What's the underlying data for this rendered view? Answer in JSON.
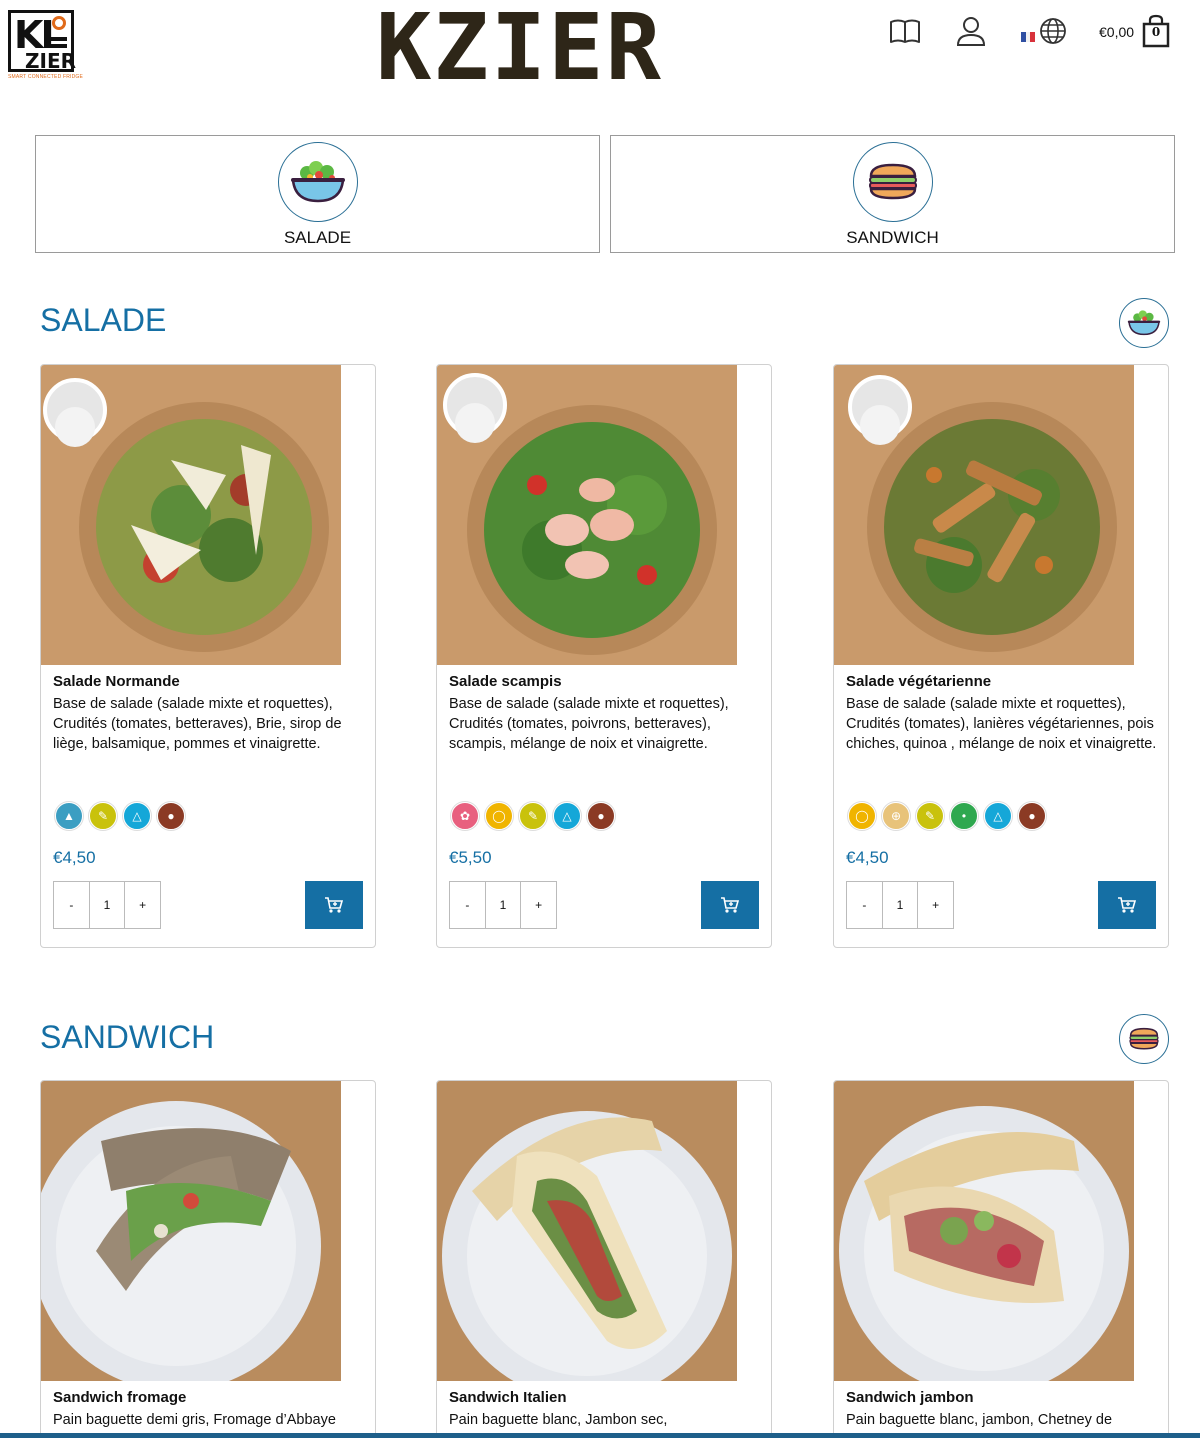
{
  "header": {
    "brand": "KZIER",
    "logo": {
      "text_ki": "KI",
      "text_zier": "ZIER",
      "tagline": "SMART CONNECTED FRIDGE"
    },
    "cart_total": "€0,00",
    "cart_count": "0",
    "icons": [
      "menu-book-icon",
      "account-icon",
      "flag-fr-icon",
      "globe-icon",
      "shopping-bag-icon"
    ]
  },
  "categories": [
    {
      "label": "SALADE",
      "icon": "salad-bowl-icon"
    },
    {
      "label": "SANDWICH",
      "icon": "sandwich-icon"
    }
  ],
  "sections": [
    {
      "title": "SALADE",
      "products": [
        {
          "name": "Salade Normande",
          "description": "Base de salade (salade mixte et roquettes), Crudités (tomates, betteraves), Brie, sirop de liège, balsamique, pommes et vinaigrette.",
          "allergens": [
            "milk-icon",
            "mustard-icon",
            "sulphite-icon",
            "nuts-icon"
          ],
          "price": "€4,50",
          "qty": "1"
        },
        {
          "name": "Salade scampis",
          "description": "Base de salade (salade mixte et roquettes), Crudités (tomates, poivrons, betteraves), scampis, mélange de noix et vinaigrette.",
          "allergens": [
            "crustacean-icon",
            "egg-icon",
            "mustard-icon",
            "sulphite-icon",
            "nuts-icon"
          ],
          "price": "€5,50",
          "qty": "1"
        },
        {
          "name": "Salade végétarienne",
          "description": "Base de salade (salade mixte et roquettes), Crudités (tomates), lanières végétariennes, pois chiches, quinoa , mélange de noix et vinaigrette.",
          "allergens": [
            "egg-icon",
            "gluten-icon",
            "mustard-icon",
            "soy-icon",
            "sulphite-icon",
            "nuts-icon"
          ],
          "price": "€4,50",
          "qty": "1"
        }
      ]
    },
    {
      "title": "SANDWICH",
      "products": [
        {
          "name": "Sandwich fromage",
          "description": "Pain baguette demi gris, Fromage d’Abbaye"
        },
        {
          "name": "Sandwich Italien",
          "description": "Pain baguette blanc, Jambon sec,"
        },
        {
          "name": "Sandwich jambon",
          "description": "Pain baguette blanc, jambon, Chetney de"
        }
      ]
    }
  ],
  "ui": {
    "minus": "-",
    "plus": "+"
  },
  "colors": {
    "accent": "#156fa4",
    "brand": "#2e2618",
    "logo_orange": "#e06a1a"
  }
}
